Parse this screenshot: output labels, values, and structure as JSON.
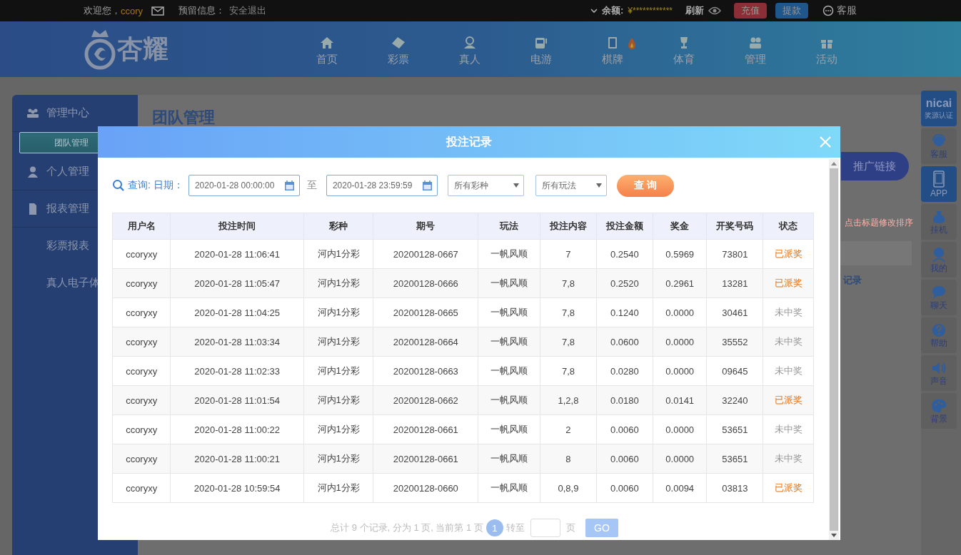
{
  "top_bar": {
    "welcome": "欢迎您，",
    "username": "ccory",
    "reserved_label": "预留信息：",
    "logout": "安全退出",
    "balance_label": "余额:",
    "balance": "¥************",
    "refresh": "刷新",
    "deposit": "充值",
    "withdraw": "提款",
    "service": "客服"
  },
  "header": {
    "logo": "杏耀",
    "nav": [
      {
        "label": "首页",
        "kind": "home"
      },
      {
        "label": "彩票",
        "kind": "ticket"
      },
      {
        "label": "真人",
        "kind": "person"
      },
      {
        "label": "电游",
        "kind": "slot"
      },
      {
        "label": "棋牌",
        "kind": "cards",
        "hot": true
      },
      {
        "label": "体育",
        "kind": "trophy"
      },
      {
        "label": "管理",
        "kind": "people"
      },
      {
        "label": "活动",
        "kind": "gift"
      }
    ]
  },
  "sidebar": {
    "items": [
      {
        "label": "管理中心",
        "kind": "team",
        "selected": false
      },
      {
        "label": "团队管理",
        "kind": "sub",
        "selected": true
      },
      {
        "label": "个人管理",
        "kind": "person",
        "selected": false
      },
      {
        "label": "报表管理",
        "kind": "report",
        "selected": false
      },
      {
        "label": "彩票报表",
        "kind": "sub",
        "selected": false
      },
      {
        "label": "真人电子体",
        "kind": "sub",
        "selected": false
      }
    ]
  },
  "content": {
    "title": "团队管理",
    "promo_button": "推广链接",
    "hint": "点击标题修改排序",
    "tab_fragment": "记录"
  },
  "right_toolbar": [
    {
      "kind": "logo",
      "logo": "nicai",
      "label": "奖源认证",
      "highlighted": true
    },
    {
      "kind": "service",
      "label": "客服",
      "highlighted": false
    },
    {
      "kind": "phone",
      "label": "APP",
      "highlighted": true
    },
    {
      "kind": "moneybag",
      "label": "挂机",
      "highlighted": false
    },
    {
      "kind": "user",
      "label": "我的",
      "highlighted": false
    },
    {
      "kind": "chat",
      "label": "聊天",
      "highlighted": false
    },
    {
      "kind": "help",
      "label": "帮助",
      "highlighted": false
    },
    {
      "kind": "sound",
      "label": "声音",
      "highlighted": false
    },
    {
      "kind": "palette",
      "label": "背景",
      "highlighted": false
    }
  ],
  "modal": {
    "title": "投注记录",
    "query_label": "查询:",
    "date_label": "日期：",
    "start": "2020-01-28 00:00:00",
    "to": "至",
    "end": "2020-01-28 23:59:59",
    "lottery_select": "所有彩种",
    "play_select": "所有玩法",
    "search_button": "查 询",
    "columns": [
      "用户名",
      "投注时间",
      "彩种",
      "期号",
      "玩法",
      "投注内容",
      "投注金额",
      "奖金",
      "开奖号码",
      "状态"
    ],
    "rows": [
      {
        "cells": [
          "ccoryxy",
          "2020-01-28 11:06:41",
          "河内1分彩",
          "20200128-0667",
          "一帆风顺",
          "7",
          "0.2540",
          "0.5969",
          "73801"
        ],
        "status": "已派奖",
        "won": true
      },
      {
        "cells": [
          "ccoryxy",
          "2020-01-28 11:05:47",
          "河内1分彩",
          "20200128-0666",
          "一帆风顺",
          "7,8",
          "0.2520",
          "0.2961",
          "13281"
        ],
        "status": "已派奖",
        "won": true
      },
      {
        "cells": [
          "ccoryxy",
          "2020-01-28 11:04:25",
          "河内1分彩",
          "20200128-0665",
          "一帆风顺",
          "7,8",
          "0.1240",
          "0.0000",
          "30461"
        ],
        "status": "未中奖",
        "won": false
      },
      {
        "cells": [
          "ccoryxy",
          "2020-01-28 11:03:34",
          "河内1分彩",
          "20200128-0664",
          "一帆风顺",
          "7,8",
          "0.0600",
          "0.0000",
          "35552"
        ],
        "status": "未中奖",
        "won": false
      },
      {
        "cells": [
          "ccoryxy",
          "2020-01-28 11:02:33",
          "河内1分彩",
          "20200128-0663",
          "一帆风顺",
          "7,8",
          "0.0280",
          "0.0000",
          "09645"
        ],
        "status": "未中奖",
        "won": false
      },
      {
        "cells": [
          "ccoryxy",
          "2020-01-28 11:01:54",
          "河内1分彩",
          "20200128-0662",
          "一帆风顺",
          "1,2,8",
          "0.0180",
          "0.0141",
          "32240"
        ],
        "status": "已派奖",
        "won": true
      },
      {
        "cells": [
          "ccoryxy",
          "2020-01-28 11:00:22",
          "河内1分彩",
          "20200128-0661",
          "一帆风顺",
          "2",
          "0.0060",
          "0.0000",
          "53651"
        ],
        "status": "未中奖",
        "won": false
      },
      {
        "cells": [
          "ccoryxy",
          "2020-01-28 11:00:21",
          "河内1分彩",
          "20200128-0661",
          "一帆风顺",
          "8",
          "0.0060",
          "0.0000",
          "53651"
        ],
        "status": "未中奖",
        "won": false
      },
      {
        "cells": [
          "ccoryxy",
          "2020-01-28 10:59:54",
          "河内1分彩",
          "20200128-0660",
          "一帆风顺",
          "0,8,9",
          "0.0060",
          "0.0094",
          "03813"
        ],
        "status": "已派奖",
        "won": true
      }
    ],
    "pager": {
      "summary": "总计 9 个记录, 分为 1 页, 当前第 1 页",
      "pages": [
        {
          "label": "1",
          "selected": true
        }
      ],
      "goto": "转至",
      "page_unit": "页",
      "go": "GO"
    }
  }
}
